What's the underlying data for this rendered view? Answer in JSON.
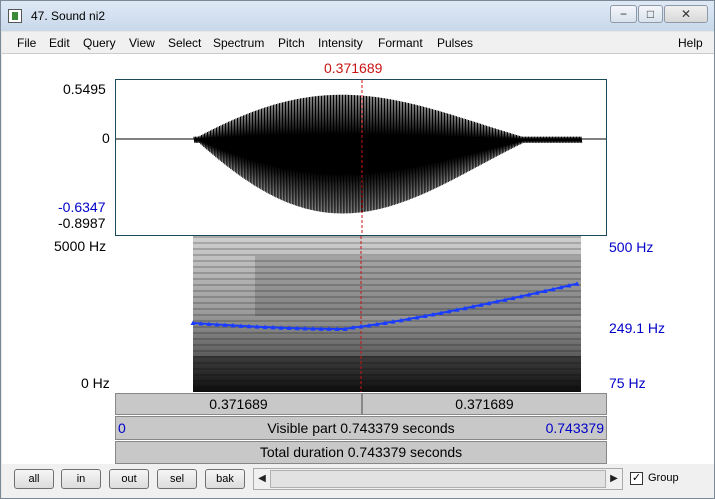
{
  "window": {
    "title": "47. Sound ni2",
    "minimize": "−",
    "maximize": "□",
    "close": "✕"
  },
  "menu": {
    "items": [
      "File",
      "Edit",
      "Query",
      "View",
      "Select",
      "Spectrum",
      "Pitch",
      "Intensity",
      "Formant",
      "Pulses"
    ],
    "help": "Help"
  },
  "cursor": {
    "time": "0.371689"
  },
  "waveform": {
    "max_label": "0.5495",
    "zero_label": "0",
    "sel_min_label": "-0.6347",
    "min_label": "-0.8987"
  },
  "spectrogram": {
    "top_freq": "5000 Hz",
    "bottom_freq": "0 Hz"
  },
  "pitch": {
    "top": "500 Hz",
    "cursor_value": "249.1 Hz",
    "bottom": "75 Hz"
  },
  "time_rows": {
    "left_time": "0.371689",
    "right_time": "0.371689",
    "visible_start": "0",
    "visible_text": "Visible part 0.743379 seconds",
    "visible_end": "0.743379",
    "total_text": "Total duration 0.743379 seconds"
  },
  "bottom": {
    "buttons": [
      "all",
      "in",
      "out",
      "sel",
      "bak"
    ],
    "group_label": "Group",
    "group_checked": "✓"
  },
  "colors": {
    "cursor": "#c81414",
    "pitch_track": "#1a3cff",
    "axis_blue": "#0000c8"
  }
}
